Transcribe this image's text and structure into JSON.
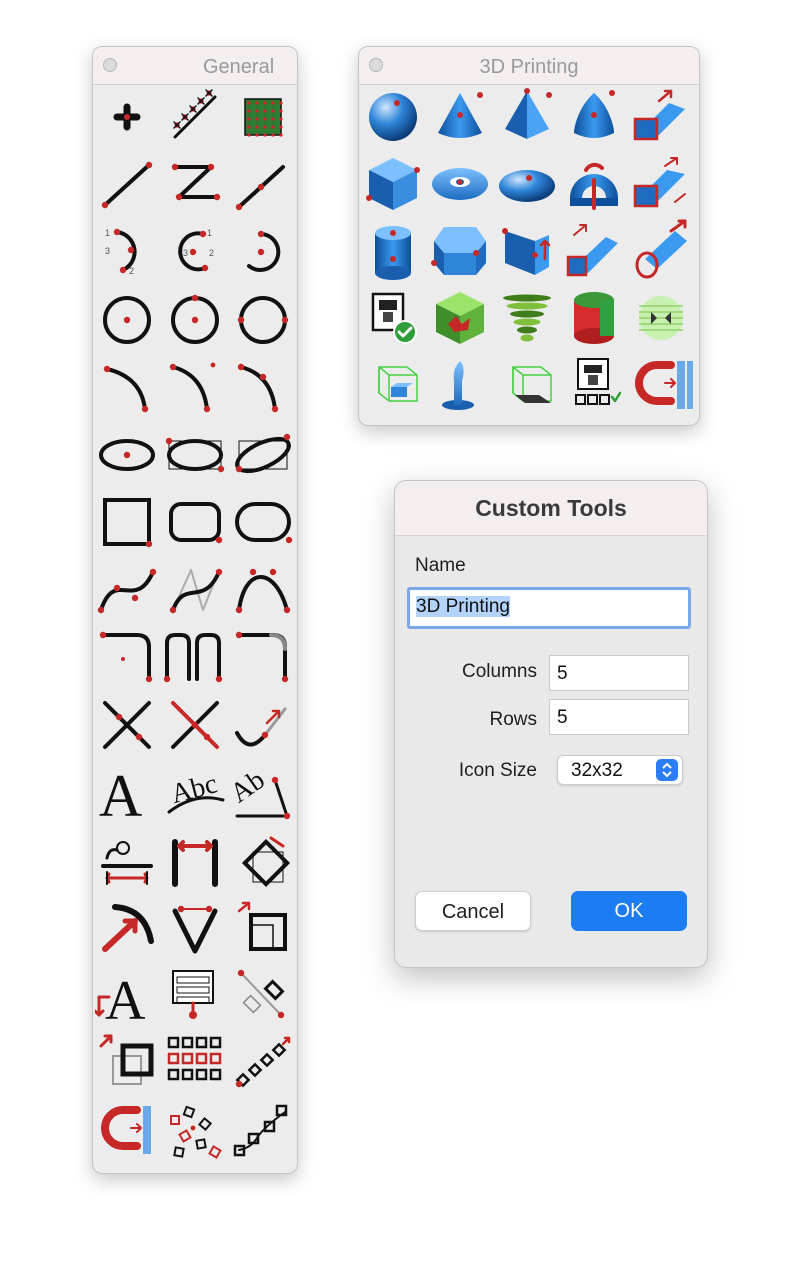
{
  "palettes": {
    "general": {
      "title": "General",
      "icons": [
        "point-tool-icon",
        "line-points-tool-icon",
        "point-grid-tool-icon",
        "line-segment-icon",
        "polyline-icon",
        "line-extend-icon",
        "arc-three-point-icon",
        "arc-center-icon",
        "arc-center-radius-icon",
        "circle-center-radius-icon",
        "circle-three-point-icon",
        "circle-two-point-icon",
        "arc-tangent-icon",
        "arc-end-icon",
        "arc-middle-icon",
        "ellipse-center-icon",
        "ellipse-box-icon",
        "ellipse-rotated-icon",
        "rectangle-icon",
        "rounded-rectangle-icon",
        "obround-icon",
        "spline-curve-icon",
        "spline-control-icon",
        "bezier-curve-icon",
        "fillet-icon",
        "double-fillet-icon",
        "chamfer-icon",
        "intersect-icon",
        "trim-icon",
        "extend-curve-icon",
        "text-icon",
        "text-on-arc-icon",
        "text-angled-icon",
        "dimension-horizontal-icon",
        "dimension-linear-icon",
        "dimension-diagonal-icon",
        "dimension-radius-icon",
        "dimension-angle-icon",
        "offset-box-icon",
        "text-move-icon",
        "table-icon",
        "tag-move-icon",
        "array-offset-icon",
        "grid-array-icon",
        "path-array-icon",
        "snap-magnet-icon",
        "scatter-array-icon",
        "path-distribute-icon"
      ]
    },
    "printing3d": {
      "title": "3D Printing",
      "icons": [
        "sphere-icon",
        "cone-icon",
        "pyramid-icon",
        "paraboloid-icon",
        "sweep-profile-icon",
        "cube-icon",
        "torus-icon",
        "ellipsoid-icon",
        "revolve-icon",
        "extrude-path-icon",
        "cylinder-icon",
        "hexagonal-prism-icon",
        "wedge-icon",
        "extrude-rectangle-icon",
        "sweep-circle-icon",
        "printer-check-icon",
        "mesh-repair-icon",
        "layered-cone-icon",
        "shell-cylinder-icon",
        "mirror-sphere-icon",
        "bounding-box-blue-icon",
        "support-stand-icon",
        "bounding-box-dark-icon",
        "printer-settings-icon",
        "snap-magnet-3d-icon"
      ]
    }
  },
  "dialog": {
    "title": "Custom Tools",
    "name_label": "Name",
    "name_value": "3D Printing",
    "columns_label": "Columns",
    "columns_value": "5",
    "rows_label": "Rows",
    "rows_value": "5",
    "icon_size_label": "Icon Size",
    "icon_size_value": "32x32",
    "cancel_label": "Cancel",
    "ok_label": "OK"
  },
  "colors": {
    "accent_blue": "#1c7cf2",
    "icon_blue": "#2a7fd0",
    "handle_red": "#c62828",
    "selection_blue": "#b3d3fb"
  }
}
